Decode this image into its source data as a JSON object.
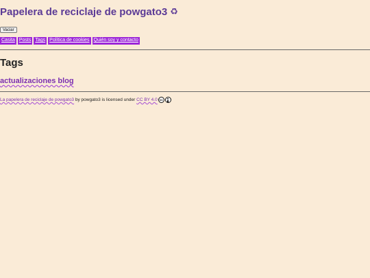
{
  "header": {
    "site_title": "Papelera de reciclaje de powgato3",
    "title_icon": "recycle-icon",
    "empty_button_label": "Vaciar"
  },
  "nav": {
    "items": [
      {
        "label": "Casita"
      },
      {
        "label": "Posts"
      },
      {
        "label": "Tags"
      },
      {
        "label": "Política de cookies"
      },
      {
        "label": "Quién soy y contacto"
      }
    ]
  },
  "main": {
    "section_title": "Tags",
    "tags": [
      {
        "label": "actualizaciones blog"
      }
    ]
  },
  "footer": {
    "work_link": "La papelera de reciclaje de powgato3",
    "license_text": " by powgato3 is licensed under ",
    "license_link": "CC BY 4.0",
    "cc_icon_text": "cc",
    "icons": [
      "creative-commons-icon",
      "attribution-icon"
    ]
  },
  "colors": {
    "background": "#faebd7",
    "title": "#5b3a96",
    "nav_background": "#9c27d8",
    "link": "#7b2fb0"
  }
}
